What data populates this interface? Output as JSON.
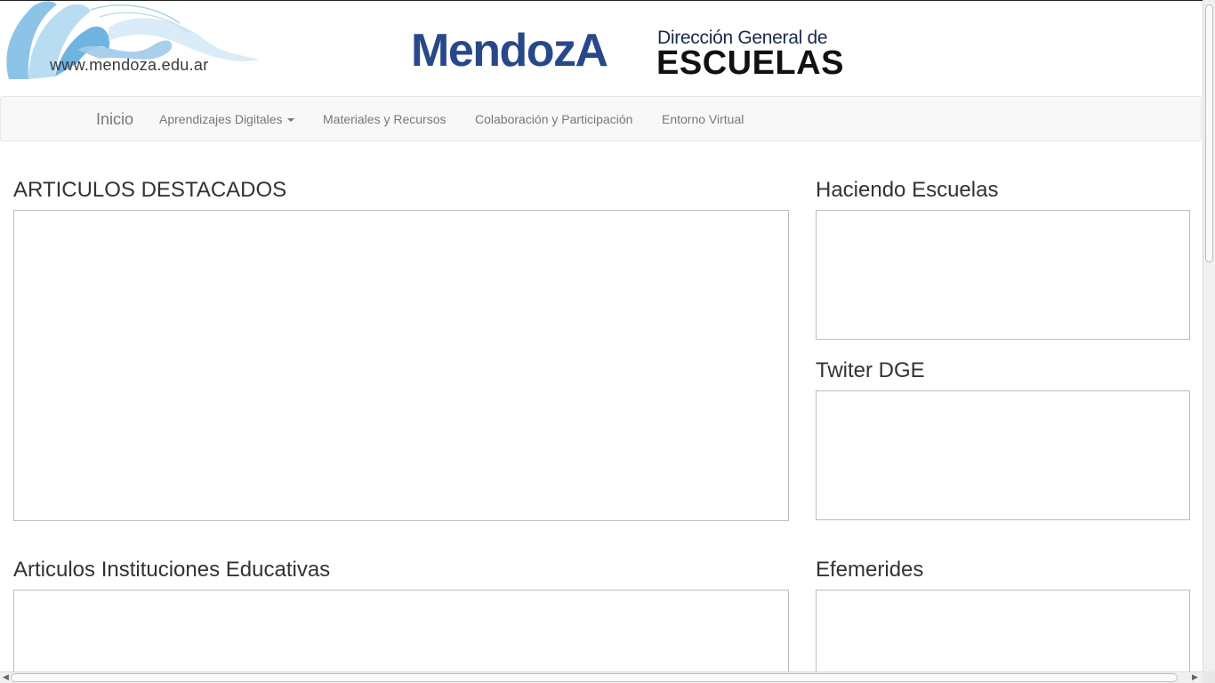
{
  "header": {
    "site_url": "www.mendoza.edu.ar",
    "brand_main": "MendozA",
    "brand_line1": "Dirección General de",
    "brand_line2": "ESCUELAS"
  },
  "navbar": {
    "brand": "Inicio",
    "items": [
      {
        "label": "Aprendizajes Digitales",
        "has_dropdown": true
      },
      {
        "label": "Materiales y Recursos"
      },
      {
        "label": "Colaboración y Participación"
      },
      {
        "label": "Entorno Virtual"
      }
    ]
  },
  "sections": {
    "destacados": "ARTICULOS DESTACADOS",
    "haciendo": "Haciendo Escuelas",
    "twitter": "Twiter DGE",
    "instituciones": "Articulos Instituciones Educativas",
    "efemerides": "Efemerides"
  },
  "colors": {
    "brand_blue": "#27498a",
    "ribbon_light": "#9fcbe8",
    "navbar_bg": "#f8f8f8"
  }
}
